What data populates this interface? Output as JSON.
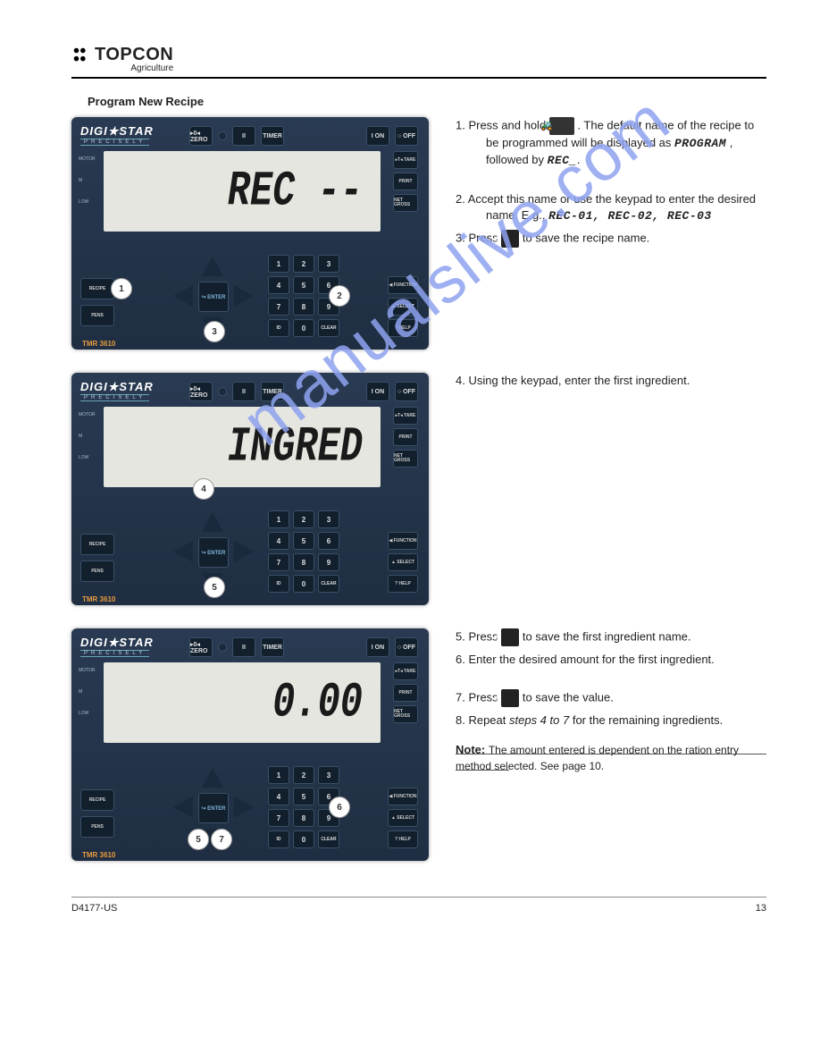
{
  "header": {
    "logo_text": "TOPCON",
    "logo_sub": "Agriculture"
  },
  "section_title": "Program New Recipe",
  "device": {
    "brand": "DIGI★STAR",
    "brand_sub": "PRECISELY",
    "model": "TMR 3610",
    "top_buttons": {
      "zero": "▸0◂\nZERO",
      "pause": "II",
      "timer": "TIMER"
    },
    "power_buttons": {
      "on": "I\nON",
      "off": "○\nOFF"
    },
    "side_labels": [
      "MOTOR",
      "M",
      "LOW"
    ],
    "right_buttons": [
      "▸T◂\nTARE",
      "PRINT",
      "NET\nGROSS"
    ],
    "left_bottom": [
      "RECIPE",
      "PENS"
    ],
    "dpad_center": "↪\nENTER",
    "keypad": [
      "1",
      "2",
      "3",
      "4",
      "5",
      "6",
      "7",
      "8",
      "9",
      ".",
      "0",
      "CLEAR"
    ],
    "keypad_row5_left": "ID",
    "right_bottom": [
      "◀\nFUNCTION",
      "▲\nSELECT",
      "?\nHELP"
    ]
  },
  "screens": {
    "s1": "REC --",
    "s2": "INGRED",
    "s3": "0.00"
  },
  "steps": {
    "s1a_prefix": "1. Press and hold ",
    "s1a_suffix": ". The default name of the recipe to be programmed will be displayed as ",
    "s1a_lcd1": "PROGRAM",
    "s1a_lcd2": "REC_",
    "s1a_after": ".",
    "s2a": "2. Accept this name or use the keypad to enter the desired name. E.g., ",
    "s2a_lcd": "REC-01, REC-02, REC-03",
    "s3a": "3. Press ",
    "s3a_suffix": " to save the recipe name.",
    "s4a": "4. Using the keypad, enter the first ingredient.",
    "s5a": "5. Press ",
    "s5a_suffix": " to save the first ingredient name.",
    "s6a": "6. Enter the desired amount for the first ingredient.",
    "s7a": "7. Press ",
    "s7a_suffix": " to save the value.",
    "s8a": "8. Repeat ",
    "s8a_ref": "steps 4 to 7",
    "s8a_suffix": " for the remaining ingredients.",
    "note_label": "Note: ",
    "note_body": "The amount entered is dependent on the ration entry method selected. See page 10."
  },
  "circles": {
    "c1": "1",
    "c2": "2",
    "c3": "3",
    "c4": "4",
    "c5": "5",
    "c6": "6",
    "c7": "7"
  },
  "footer": {
    "left": "D4177-US",
    "right": "13"
  },
  "watermark": "manualslive.com"
}
